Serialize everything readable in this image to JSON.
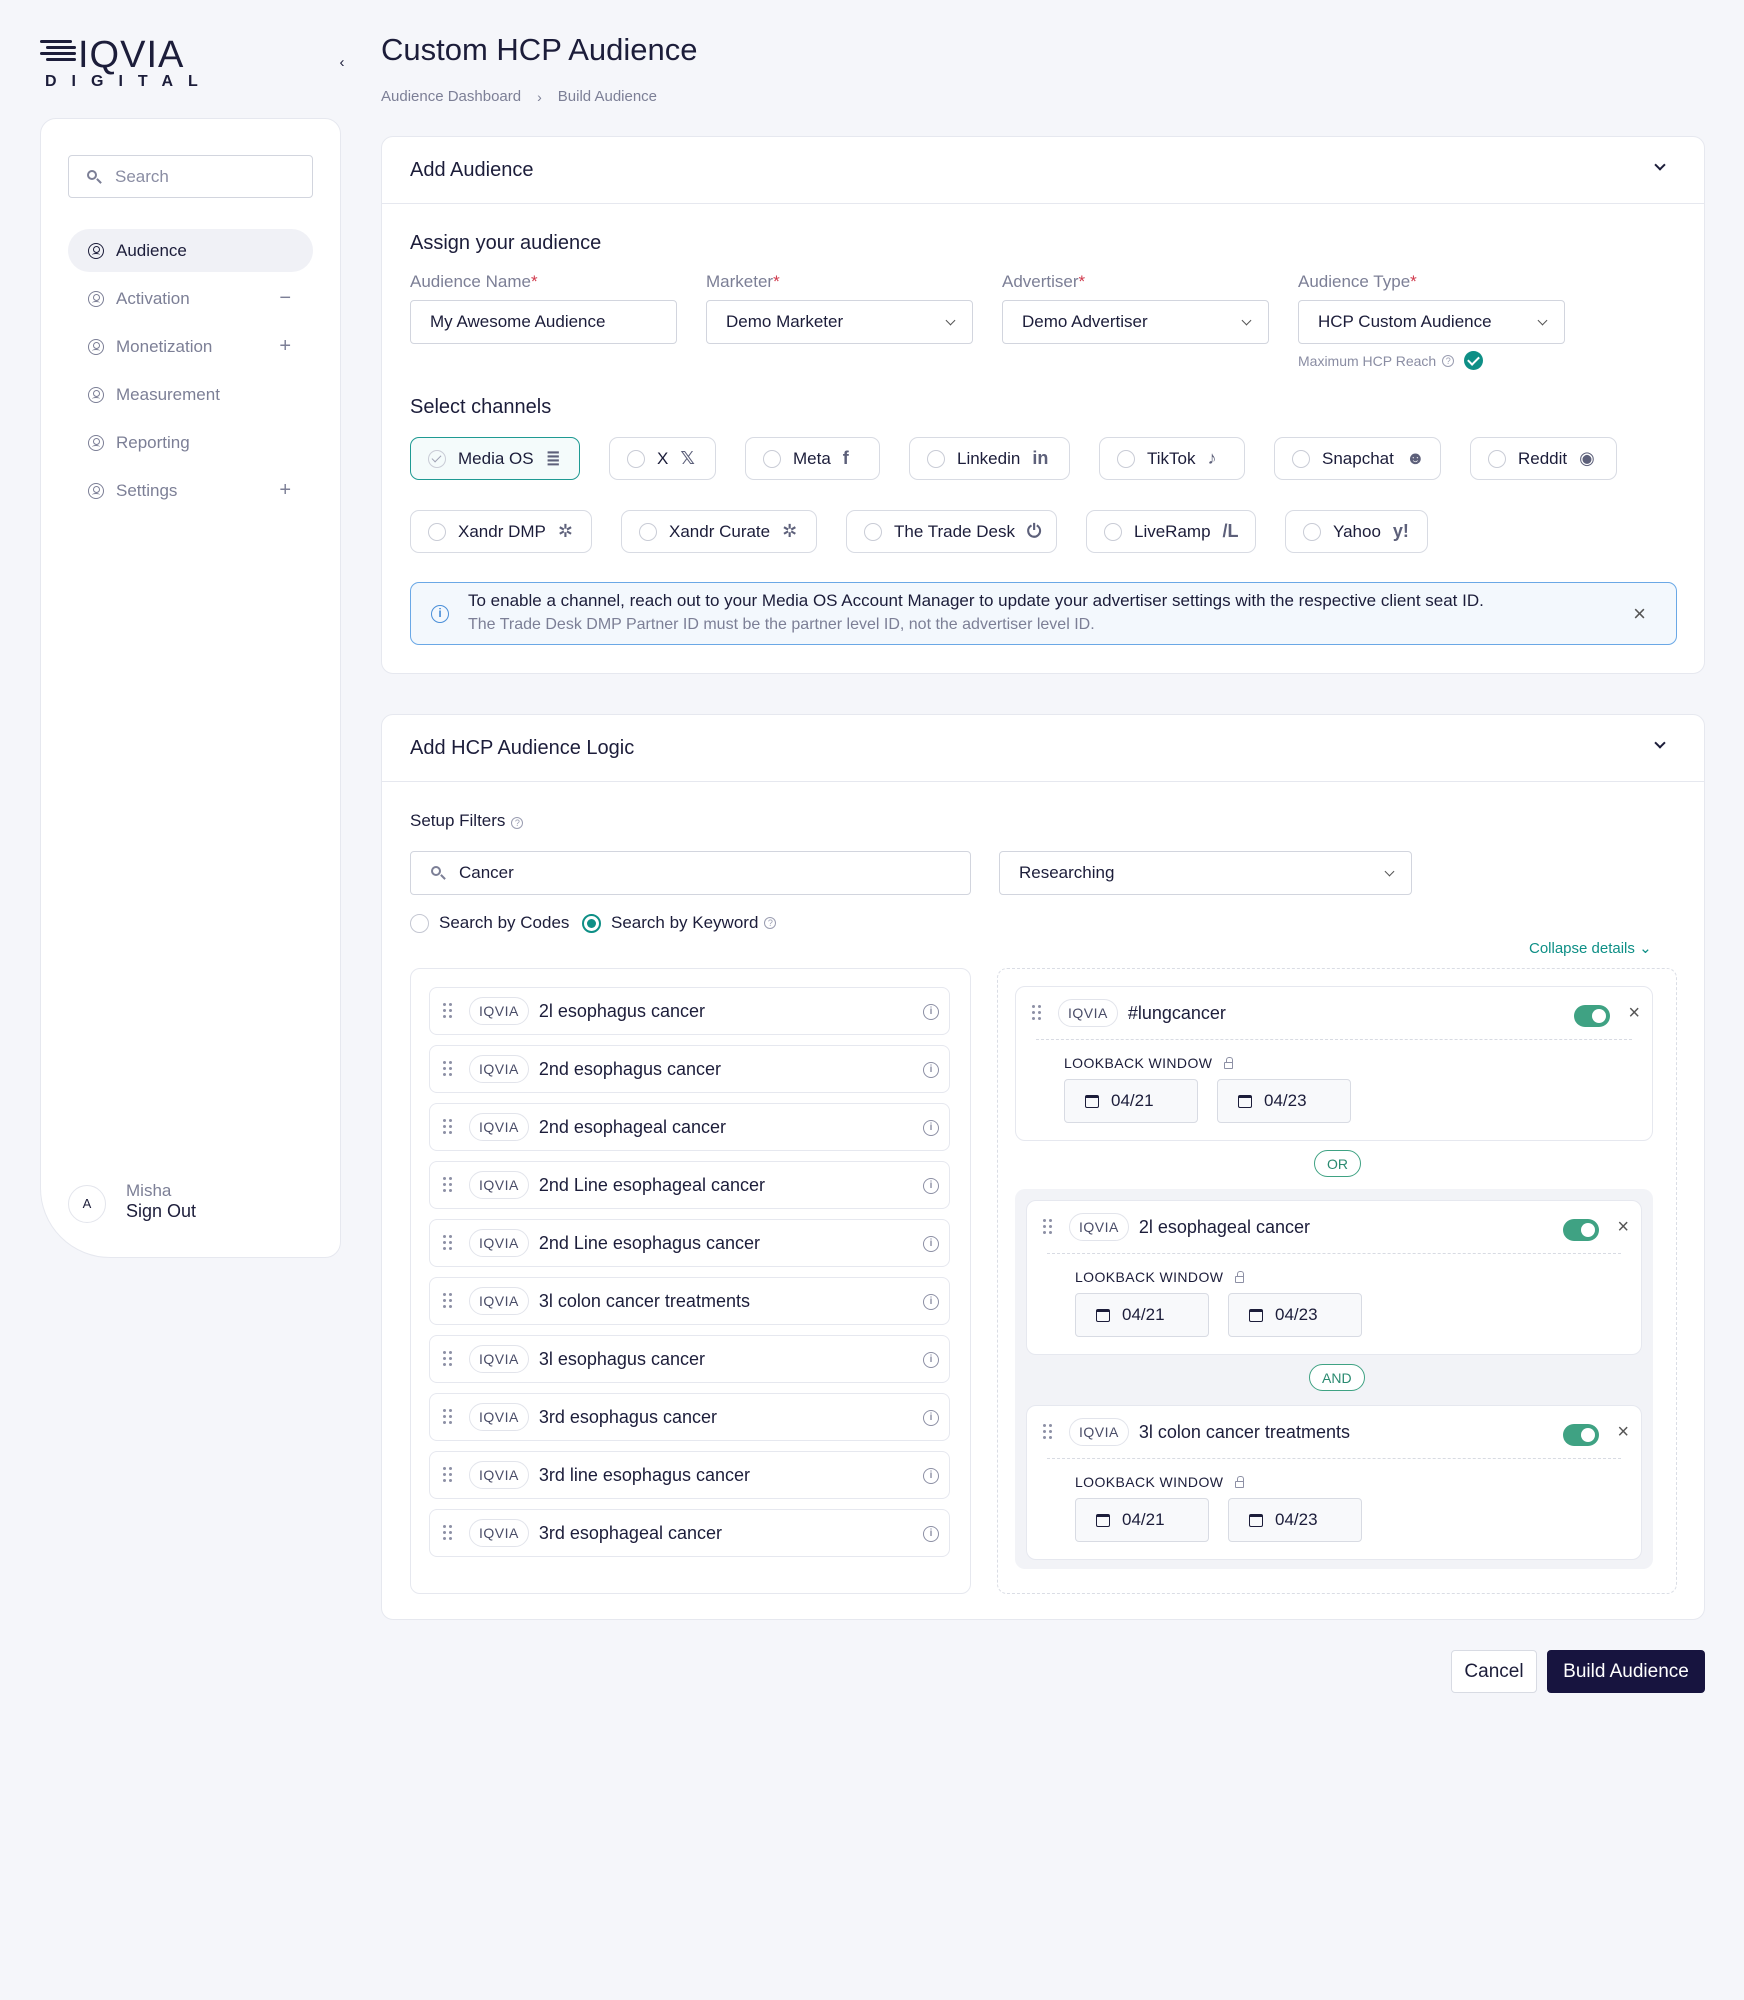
{
  "brand": {
    "wordmark": "IQVIA",
    "sub": "DIGITAL"
  },
  "sidebar": {
    "search_placeholder": "Search",
    "items": [
      {
        "label": "Audience",
        "sign": "",
        "active": true
      },
      {
        "label": "Activation",
        "sign": "−"
      },
      {
        "label": "Monetization",
        "sign": "+"
      },
      {
        "label": "Measurement",
        "sign": ""
      },
      {
        "label": "Reporting",
        "sign": ""
      },
      {
        "label": "Settings",
        "sign": "+"
      }
    ],
    "user": {
      "initial": "A",
      "name": "Misha",
      "action": "Sign Out"
    }
  },
  "header": {
    "title": "Custom HCP Audience",
    "breadcrumb": [
      "Audience Dashboard",
      "Build Audience"
    ]
  },
  "add_audience": {
    "title": "Add Audience",
    "assign_title": "Assign your audience",
    "fields": {
      "name_label": "Audience Name",
      "name_value": "My Awesome Audience",
      "marketer_label": "Marketer",
      "marketer_value": "Demo Marketer",
      "advertiser_label": "Advertiser",
      "advertiser_value": "Demo Advertiser",
      "type_label": "Audience Type",
      "type_value": "HCP Custom Audience"
    },
    "required_mark": "*",
    "max_reach": "Maximum HCP Reach",
    "channels_title": "Select channels",
    "channels": [
      {
        "label": "Media OS",
        "icon": "≣",
        "selected": true
      },
      {
        "label": "X",
        "icon": "𝕏"
      },
      {
        "label": "Meta",
        "icon": "f"
      },
      {
        "label": "Linkedin",
        "icon": "in"
      },
      {
        "label": "TikTok",
        "icon": "♪"
      },
      {
        "label": "Snapchat",
        "icon": "☻"
      },
      {
        "label": "Reddit",
        "icon": "◉"
      },
      {
        "label": "Xandr DMP",
        "icon": "✲"
      },
      {
        "label": "Xandr Curate",
        "icon": "✲"
      },
      {
        "label": "The Trade Desk",
        "icon": "⏻"
      },
      {
        "label": "LiveRamp",
        "icon": "/L"
      },
      {
        "label": "Yahoo",
        "icon": "y!"
      }
    ],
    "notice": {
      "line1": "To enable a channel, reach out to your Media OS Account Manager to update your advertiser settings with the respective client seat ID.",
      "line2": "The Trade Desk DMP Partner ID must be the partner level ID, not the advertiser level ID."
    }
  },
  "logic": {
    "title": "Add HCP Audience Logic",
    "setup_filters": "Setup Filters",
    "search_value": "Cancer",
    "intent_value": "Researching",
    "radio_codes": "Search by Codes",
    "radio_keyword": "Search by Keyword",
    "collapse": "Collapse details",
    "badge": "IQVIA",
    "results": [
      "2l esophagus cancer",
      "2nd esophagus cancer",
      "2nd esophageal cancer",
      "2nd Line esophageal cancer",
      "2nd Line esophagus cancer",
      "3l colon cancer treatments",
      "3l esophagus cancer",
      "3rd esophagus cancer",
      "3rd line esophagus cancer",
      "3rd esophageal cancer"
    ],
    "lookback": "LOOKBACK WINDOW",
    "rules": [
      {
        "label": "#lungcancer",
        "from": "04/21",
        "to": "04/23"
      },
      {
        "label": "2l esophageal cancer",
        "from": "04/21",
        "to": "04/23"
      },
      {
        "label": "3l colon cancer treatments",
        "from": "04/21",
        "to": "04/23"
      }
    ],
    "op_or": "OR",
    "op_and": "AND"
  },
  "actions": {
    "cancel": "Cancel",
    "build": "Build Audience"
  },
  "colors": {
    "accent": "#0e8f86",
    "primary": "#17143f",
    "toggle": "#3fa283",
    "info": "#4a8fd8"
  }
}
